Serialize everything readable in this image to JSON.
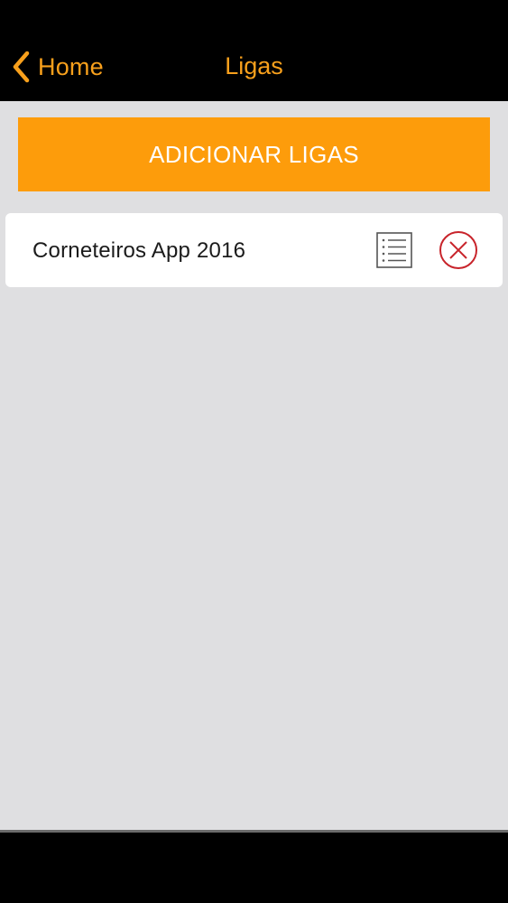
{
  "navbar": {
    "back_label": "Home",
    "title": "Ligas"
  },
  "actions": {
    "add_label": "ADICIONAR LIGAS"
  },
  "leagues": [
    {
      "name": "Corneteiros App 2016",
      "list_icon": "list-icon",
      "remove_icon": "remove-circle-x-icon"
    }
  ],
  "colors": {
    "accent": "#f8a01c",
    "button": "#fd9c0b",
    "remove": "#c8242b",
    "background": "#dfdfe1",
    "bar": "#000000"
  },
  "icons": {
    "back": "chevron-left-icon"
  }
}
